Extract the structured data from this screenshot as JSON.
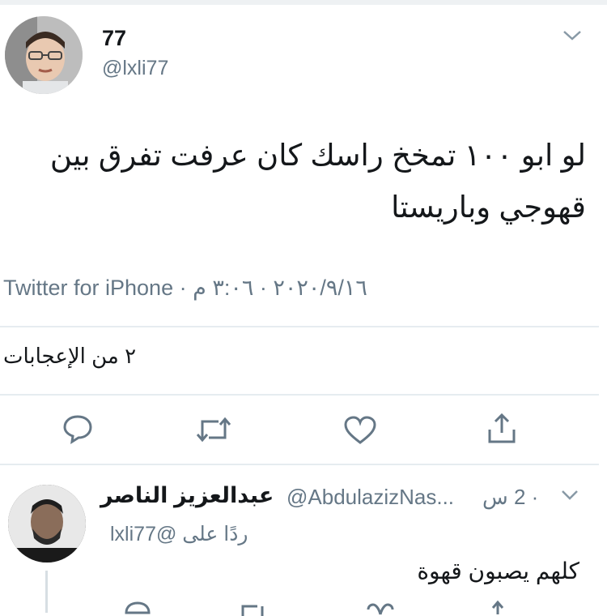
{
  "tweet": {
    "display_name": "77",
    "handle": "@lxli77",
    "text_line1": "لو ابو ١٠٠ تمخخ راسك كان عرفت تفرق بين",
    "text_line2": "قهوجي وباريستا",
    "meta": "Twitter for iPhone · ٢٠٢٠/٩/١٦ · ٣:٠٦ م",
    "likes": "٢ من الإعجابات"
  },
  "reply": {
    "display_name": "عبدالعزيز الناصر",
    "handle": "@AbdulazizNas...",
    "time": "· 2 س",
    "replying_to": "ردًا على @lxli77",
    "text": "كلهم يصبون قهوة"
  },
  "icons": {
    "caret": "chevron-down-icon",
    "reply": "reply-icon",
    "retweet": "retweet-icon",
    "like": "heart-icon",
    "share": "share-icon"
  }
}
